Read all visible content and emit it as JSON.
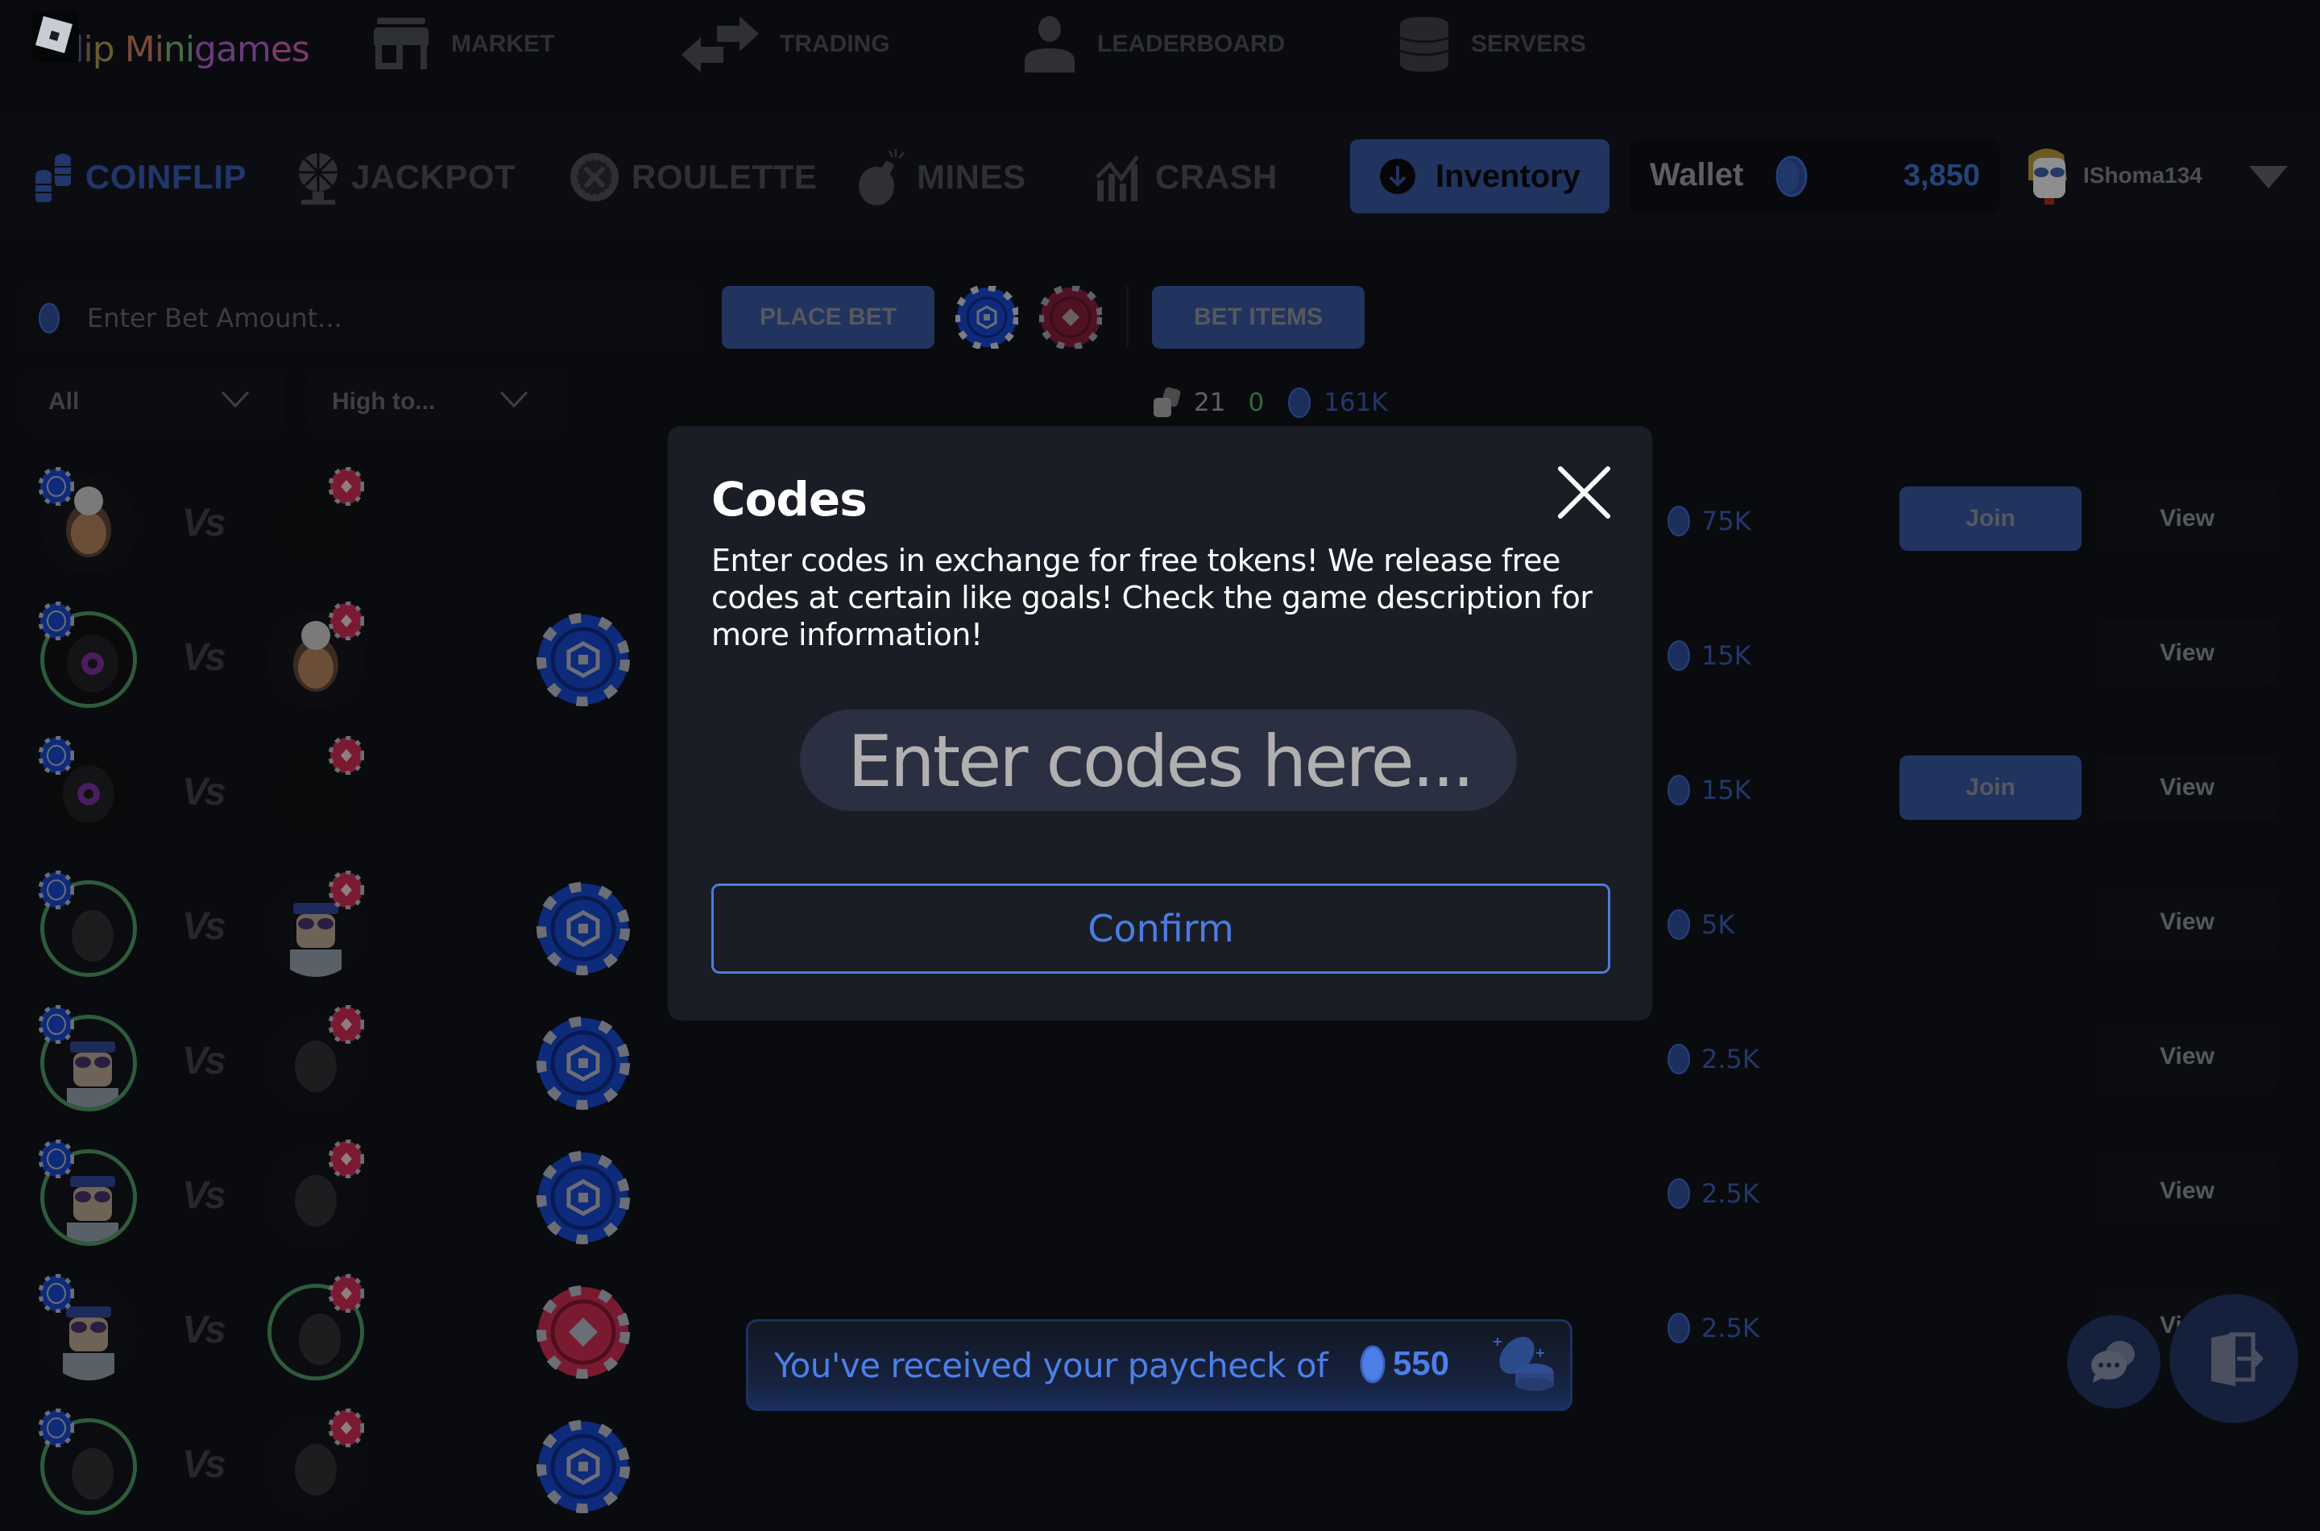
{
  "app": {
    "logo_text": "Flip Minigames",
    "logo_letters": [
      {
        "ch": "F",
        "color": "#2b2d5c"
      },
      {
        "ch": "l",
        "color": "#3a3a6a"
      },
      {
        "ch": "i",
        "color": "#5a4a3a"
      },
      {
        "ch": "p",
        "color": "#6a5a30"
      },
      {
        "ch": " ",
        "color": "#000000"
      },
      {
        "ch": "M",
        "color": "#7a4a3a"
      },
      {
        "ch": "i",
        "color": "#6a4a40"
      },
      {
        "ch": "n",
        "color": "#4a6a40"
      },
      {
        "ch": "i",
        "color": "#3a6a50"
      },
      {
        "ch": "g",
        "color": "#6a3a7a"
      },
      {
        "ch": "a",
        "color": "#6a3a7a"
      },
      {
        "ch": "m",
        "color": "#6a3a7a"
      },
      {
        "ch": "e",
        "color": "#7a3a6a"
      },
      {
        "ch": "s",
        "color": "#7a3a6a"
      }
    ]
  },
  "topnav": [
    {
      "label": "MARKET",
      "icon": "store-icon"
    },
    {
      "label": "TRADING",
      "icon": "swap-arrows-icon"
    },
    {
      "label": "LEADERBOARD",
      "icon": "person-icon"
    },
    {
      "label": "SERVERS",
      "icon": "database-icon"
    }
  ],
  "game_tabs": [
    {
      "label": "COINFLIP",
      "icon": "coin-stack-icon",
      "active": true
    },
    {
      "label": "JACKPOT",
      "icon": "prize-wheel-icon",
      "active": false
    },
    {
      "label": "ROULETTE",
      "icon": "roulette-icon",
      "active": false
    },
    {
      "label": "MINES",
      "icon": "bomb-icon",
      "active": false
    },
    {
      "label": "CRASH",
      "icon": "chart-up-icon",
      "active": false
    }
  ],
  "header": {
    "inventory_label": "Inventory",
    "wallet_label": "Wallet",
    "wallet_value": "3,850",
    "username": "IShoma134"
  },
  "bet_bar": {
    "placeholder": "Enter Bet Amount...",
    "value": "",
    "place_bet_label": "PLACE BET",
    "bet_items_label": "BET ITEMS"
  },
  "filters": {
    "type_selected": "All",
    "sort_selected": "High to..."
  },
  "stats": {
    "games_count": "21",
    "active_count": "0",
    "total_value": "161K"
  },
  "games": [
    {
      "left_winner": false,
      "right_winner": false,
      "right_empty": true,
      "result_side": "",
      "amount": "75K",
      "joinable": true
    },
    {
      "left_winner": true,
      "right_winner": false,
      "right_empty": false,
      "result_side": "blue",
      "amount": "15K",
      "joinable": false
    },
    {
      "left_winner": false,
      "right_winner": false,
      "right_empty": true,
      "result_side": "",
      "amount": "15K",
      "joinable": true
    },
    {
      "left_winner": true,
      "right_winner": false,
      "right_empty": false,
      "result_side": "blue",
      "amount": "5K",
      "joinable": false
    },
    {
      "left_winner": true,
      "right_winner": false,
      "right_empty": false,
      "result_side": "blue",
      "amount": "2.5K",
      "joinable": false
    },
    {
      "left_winner": true,
      "right_winner": false,
      "right_empty": false,
      "result_side": "blue",
      "amount": "2.5K",
      "joinable": false
    },
    {
      "left_winner": false,
      "right_winner": true,
      "right_empty": false,
      "result_side": "red",
      "amount": "2.5K",
      "joinable": false
    },
    {
      "left_winner": true,
      "right_winner": false,
      "right_empty": false,
      "result_side": "blue",
      "amount": "",
      "joinable": false
    }
  ],
  "row_labels": {
    "vs": "Vs",
    "join": "Join",
    "view": "View"
  },
  "modal": {
    "title": "Codes",
    "description": "Enter codes in exchange for free tokens! We release free codes at certain like goals! Check the game description for more information!",
    "input_placeholder": "Enter codes here...",
    "input_value": "",
    "confirm_label": "Confirm"
  },
  "toast": {
    "message": "You've received your paycheck of",
    "amount": "550"
  },
  "colors": {
    "accent_blue": "#4a7ce0",
    "dim_blue": "#21345f",
    "win_green": "#2f5b3a",
    "chip_red": "#8a1e34",
    "chip_blue": "#0e2a7a"
  }
}
